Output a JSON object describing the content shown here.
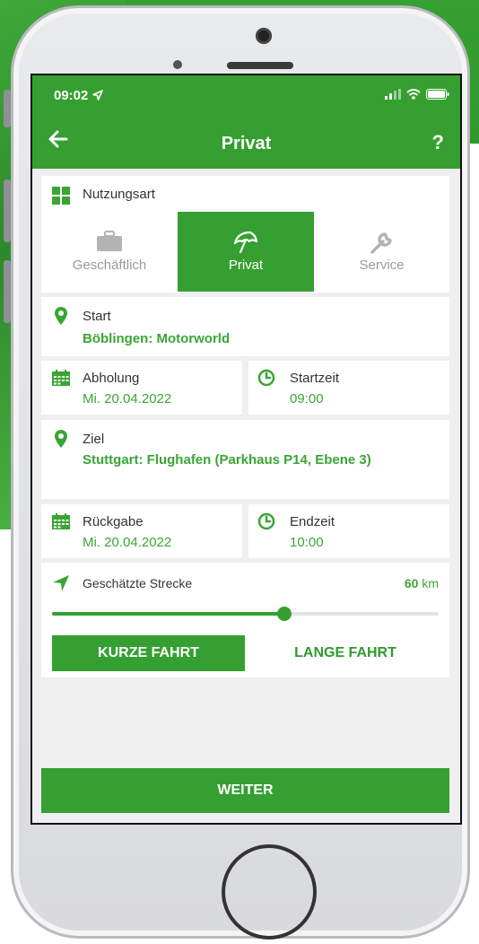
{
  "status_bar": {
    "time": "09:02"
  },
  "header": {
    "title": "Privat",
    "back_icon": "arrow-left-icon",
    "help_label": "?"
  },
  "usage": {
    "title": "Nutzungsart",
    "options": [
      {
        "label": "Geschäftlich",
        "icon": "briefcase-icon",
        "selected": false
      },
      {
        "label": "Privat",
        "icon": "umbrella-icon",
        "selected": true
      },
      {
        "label": "Service",
        "icon": "wrench-icon",
        "selected": false
      }
    ]
  },
  "start": {
    "label": "Start",
    "value": "Böblingen: Motorworld"
  },
  "pickup": {
    "label": "Abholung",
    "value": "Mi. 20.04.2022"
  },
  "start_time": {
    "label": "Startzeit",
    "value": "09:00"
  },
  "destination": {
    "label": "Ziel",
    "value": "Stuttgart: Flughafen (Parkhaus P14, Ebene 3)"
  },
  "return": {
    "label": "Rückgabe",
    "value": "Mi. 20.04.2022"
  },
  "end_time": {
    "label": "Endzeit",
    "value": "10:00"
  },
  "distance": {
    "label": "Geschätzte Strecke",
    "value": "60",
    "unit": "km",
    "slider_fraction": 0.6
  },
  "trip_buttons": {
    "short": "KURZE FAHRT",
    "long": "LANGE FAHRT",
    "selected": "short"
  },
  "footer": {
    "next_label": "WEITER"
  },
  "colors": {
    "accent": "#35a031",
    "accent_text": "#3aa535"
  }
}
